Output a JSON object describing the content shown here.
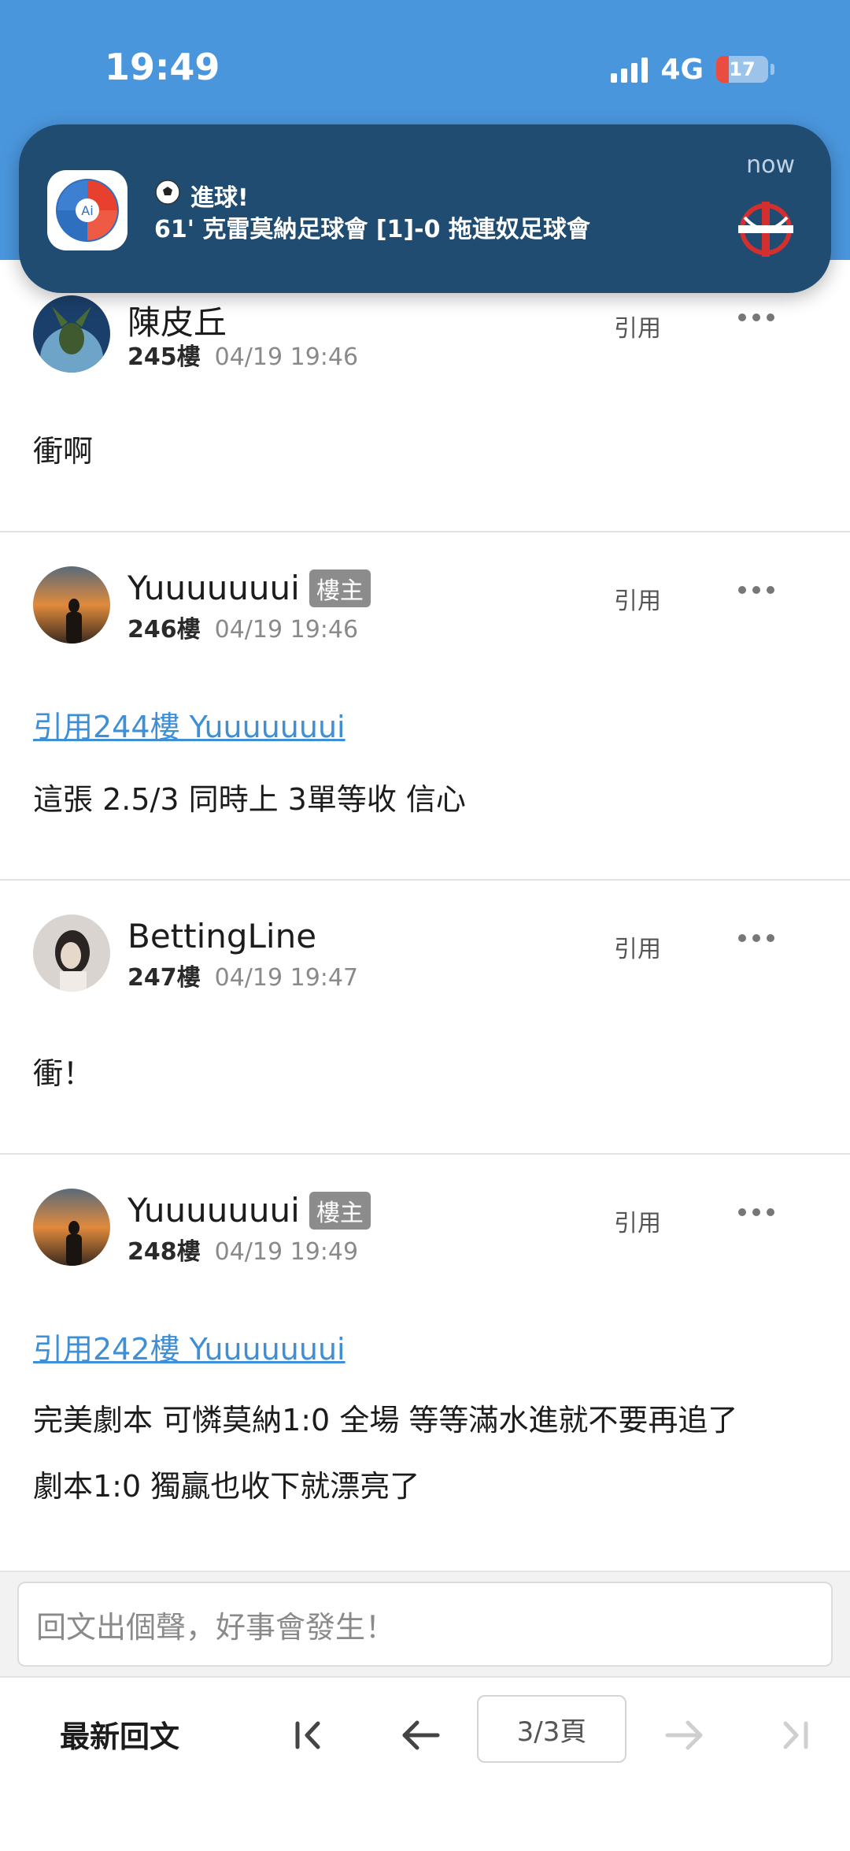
{
  "status_bar": {
    "time": "19:49",
    "network": "4G",
    "battery": "17"
  },
  "notification": {
    "title": "進球!",
    "body": "61' 克雷莫納足球會 [1]-0 拖連奴足球會",
    "time": "now",
    "app_icon_text": "Ai"
  },
  "posts": [
    {
      "username": "陳皮丘",
      "floor": "245樓",
      "date": "04/19 19:46",
      "quote_label": "引用",
      "body": "衝啊"
    },
    {
      "username": "Yuuuuuuui",
      "op_badge": "樓主",
      "floor": "246樓",
      "date": "04/19 19:46",
      "quote_label": "引用",
      "quote_ref": "引用244樓 Yuuuuuuui",
      "body": "這張 2.5/3 同時上 3單等收 信心"
    },
    {
      "username": "BettingLine",
      "floor": "247樓",
      "date": "04/19 19:47",
      "quote_label": "引用",
      "body": "衝！"
    },
    {
      "username": "Yuuuuuuui",
      "op_badge": "樓主",
      "floor": "248樓",
      "date": "04/19 19:49",
      "quote_label": "引用",
      "quote_ref": "引用242樓 Yuuuuuuui",
      "body_lines": [
        "完美劇本 可憐莫納1:0 全場 等等滿水進就不要再追了",
        "劇本1:0 獨贏也收下就漂亮了"
      ]
    }
  ],
  "reply": {
    "placeholder": "回文出個聲，好事會發生！"
  },
  "bottom_nav": {
    "latest": "最新回文",
    "page": "3/3頁"
  },
  "colors": {
    "header": "#4a96dd",
    "link": "#3f8fd6",
    "notification": "#204c72",
    "op_badge": "#8c8c8c"
  }
}
